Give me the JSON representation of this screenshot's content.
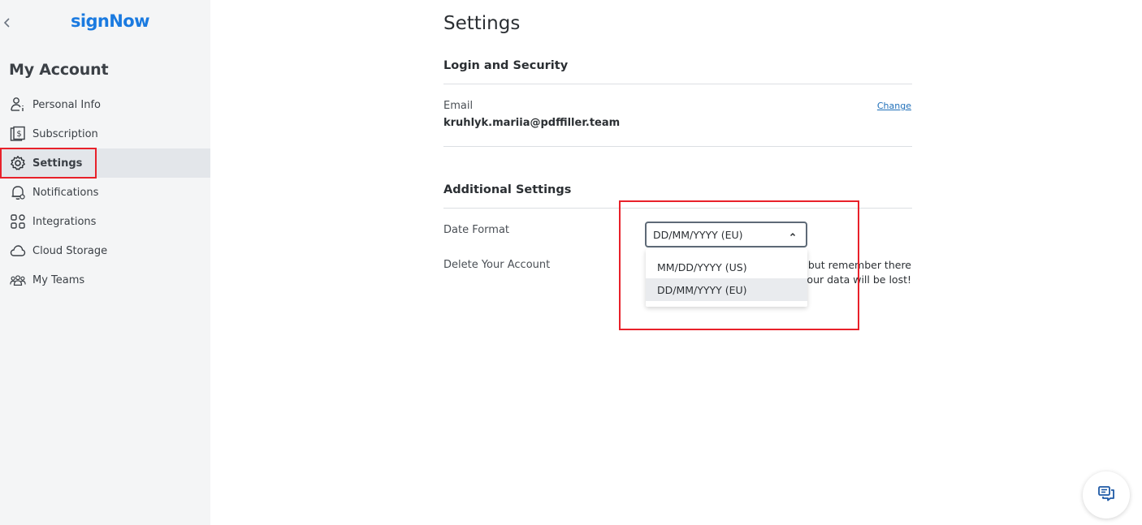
{
  "app": {
    "logo": "signNow",
    "back_icon": "chevron-left-icon"
  },
  "sidebar": {
    "title": "My Account",
    "items": [
      {
        "label": "Personal Info",
        "icon": "person-info-icon",
        "active": false
      },
      {
        "label": "Subscription",
        "icon": "dollar-document-icon",
        "active": false
      },
      {
        "label": "Settings",
        "icon": "gear-icon",
        "active": true
      },
      {
        "label": "Notifications",
        "icon": "bell-icon",
        "active": false
      },
      {
        "label": "Integrations",
        "icon": "grid-icon",
        "active": false
      },
      {
        "label": "Cloud Storage",
        "icon": "cloud-icon",
        "active": false
      },
      {
        "label": "My Teams",
        "icon": "team-icon",
        "active": false
      }
    ]
  },
  "main": {
    "title": "Settings",
    "login_security": {
      "title": "Login and Security",
      "email_label": "Email",
      "email_value": "kruhlyk.mariia@pdffiller.team",
      "change_label": "Change"
    },
    "additional": {
      "title": "Additional Settings",
      "date_format_label": "Date Format",
      "date_format_value": "DD/MM/YYYY (EU)",
      "date_format_options": [
        "MM/DD/YYYY (US)",
        "DD/MM/YYYY (EU)"
      ],
      "delete_label": "Delete Your Account",
      "delete_note_line1": "t but remember there",
      "delete_note_line2": "our data will be lost!"
    }
  },
  "colors": {
    "brand": "#1a7ae0",
    "highlight": "#e8212a",
    "link": "#1f6fb9"
  }
}
